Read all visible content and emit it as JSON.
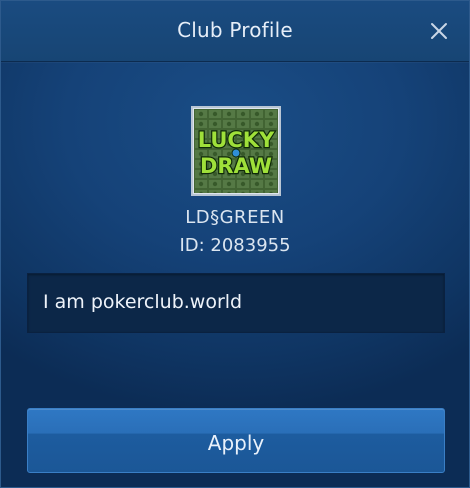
{
  "header": {
    "title": "Club Profile",
    "close_icon": "close-icon"
  },
  "club": {
    "avatar_text_top": "LUCKY",
    "avatar_text_bottom": "DRAW",
    "name": "LD§GREEN",
    "id_text": "ID: 2083955"
  },
  "description": {
    "value": "I am pokerclub.world"
  },
  "footer": {
    "apply_label": "Apply"
  },
  "colors": {
    "accent": "#2a6fb8",
    "background": "#154278",
    "avatar_green": "#3f8a2e"
  }
}
